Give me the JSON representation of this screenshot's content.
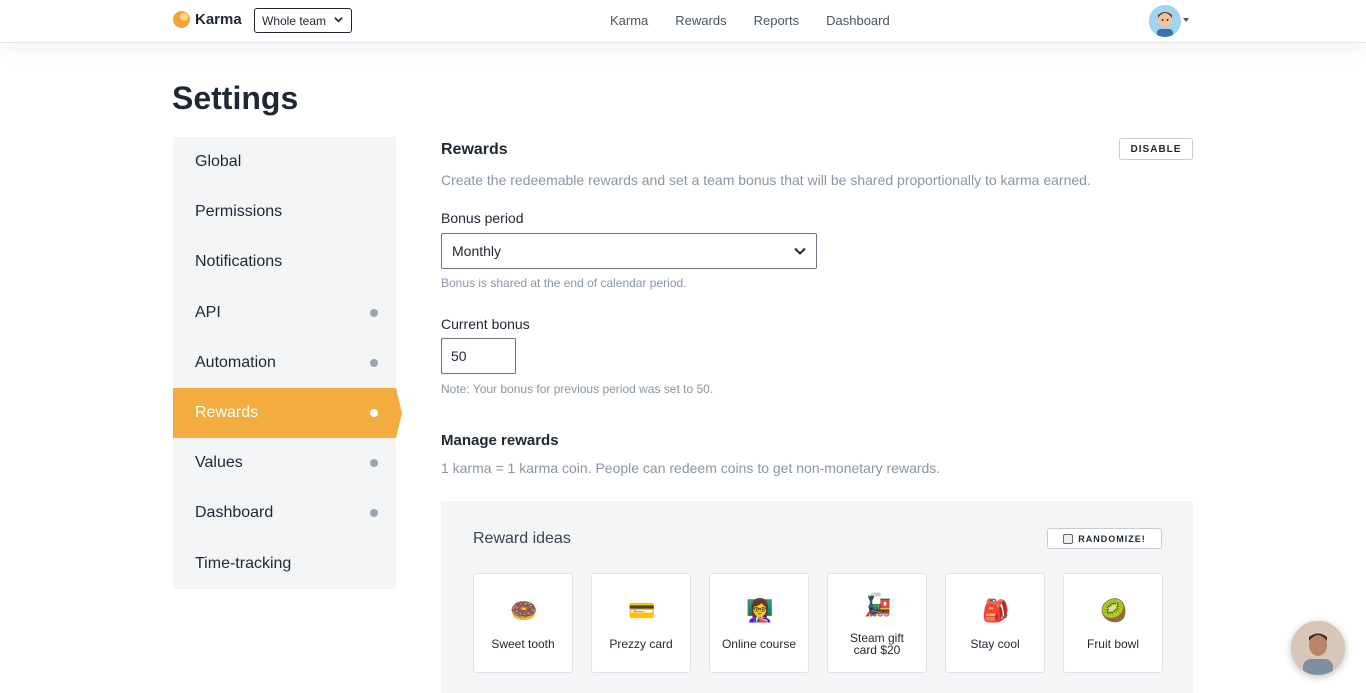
{
  "app": {
    "brand": "Karma",
    "team_filter": "Whole team"
  },
  "nav": {
    "links": [
      "Karma",
      "Rewards",
      "Reports",
      "Dashboard"
    ]
  },
  "page": {
    "title": "Settings"
  },
  "sidebar": {
    "items": [
      {
        "label": "Global",
        "dot": false
      },
      {
        "label": "Permissions",
        "dot": false
      },
      {
        "label": "Notifications",
        "dot": false
      },
      {
        "label": "API",
        "dot": true
      },
      {
        "label": "Automation",
        "dot": true
      },
      {
        "label": "Rewards",
        "dot": true,
        "active": true
      },
      {
        "label": "Values",
        "dot": true
      },
      {
        "label": "Dashboard",
        "dot": true
      },
      {
        "label": "Time-tracking",
        "dot": false
      }
    ]
  },
  "rewards": {
    "title": "Rewards",
    "disable_label": "DISABLE",
    "description": "Create the redeemable rewards and set a team bonus that will be shared proportionally to karma earned.",
    "bonus_period_label": "Bonus period",
    "bonus_period_value": "Monthly",
    "bonus_period_help": "Bonus is shared at the end of calendar period.",
    "current_bonus_label": "Current bonus",
    "current_bonus_value": "50",
    "current_bonus_note": "Note: Your bonus for previous period was set to 50."
  },
  "manage": {
    "title": "Manage rewards",
    "description": "1 karma = 1 karma coin. People can redeem coins to get non-monetary rewards."
  },
  "ideas": {
    "title": "Reward ideas",
    "randomize_label": "RANDOMIZE!",
    "cards": [
      {
        "label": "Sweet tooth",
        "icon": "🍩"
      },
      {
        "label": "Prezzy card",
        "icon": "💳"
      },
      {
        "label": "Online course",
        "icon": "👩‍🏫"
      },
      {
        "label": "Steam gift card $20",
        "icon": "🚂"
      },
      {
        "label": "Stay cool",
        "icon": "🎒"
      },
      {
        "label": "Fruit bowl",
        "icon": "🥝"
      }
    ]
  },
  "colors": {
    "accent": "#f3ac40",
    "sidebar_bg": "#f3f5f7",
    "muted": "#8995a5",
    "text": "#1f2733"
  }
}
